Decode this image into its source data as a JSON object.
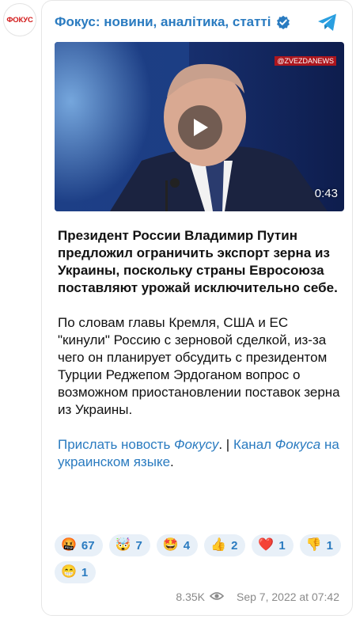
{
  "avatar_text": "ФОКУС",
  "channel": {
    "title": "Фокус: новини, аналітика, статті"
  },
  "video": {
    "watermark": "@ZVEZDANEWS",
    "duration": "0:43"
  },
  "post": {
    "headline": "Президент России Владимир Путин предложил ограничить экспорт зерна из Украины, поскольку страны Евросоюза поставляют урожай исключительно себе.",
    "body": "По словам главы Кремля, США и ЕС \"кинули\" Россию с зерновой сделкой, из-за чего он планирует обсудить с президентом Турции Реджепом Эрдоганом вопрос о возможном приостановлении поставок зерна из Украины.",
    "link1_text": "Прислать новость ",
    "link1_italic": "Фокусу",
    "separator": ". | ",
    "link2_text": "Канал ",
    "link2_italic": "Фокуса",
    "link2_tail": " на украинском языке",
    "end": "."
  },
  "reactions": [
    {
      "emoji": "🤬",
      "count": "67"
    },
    {
      "emoji": "🤯",
      "count": "7"
    },
    {
      "emoji": "🤩",
      "count": "4"
    },
    {
      "emoji": "👍",
      "count": "2"
    },
    {
      "emoji": "❤️",
      "count": "1"
    },
    {
      "emoji": "👎",
      "count": "1"
    },
    {
      "emoji": "😁",
      "count": "1"
    }
  ],
  "footer": {
    "views": "8.35K",
    "date": "Sep 7, 2022 at 07:42"
  },
  "colors": {
    "accent": "#2a7bc0",
    "pill_bg": "#e8f0f8",
    "brand_red": "#d21a1a"
  },
  "icons": {
    "verified": "verified-badge-icon",
    "telegram": "telegram-icon",
    "play": "play-icon",
    "views": "eye-icon"
  }
}
